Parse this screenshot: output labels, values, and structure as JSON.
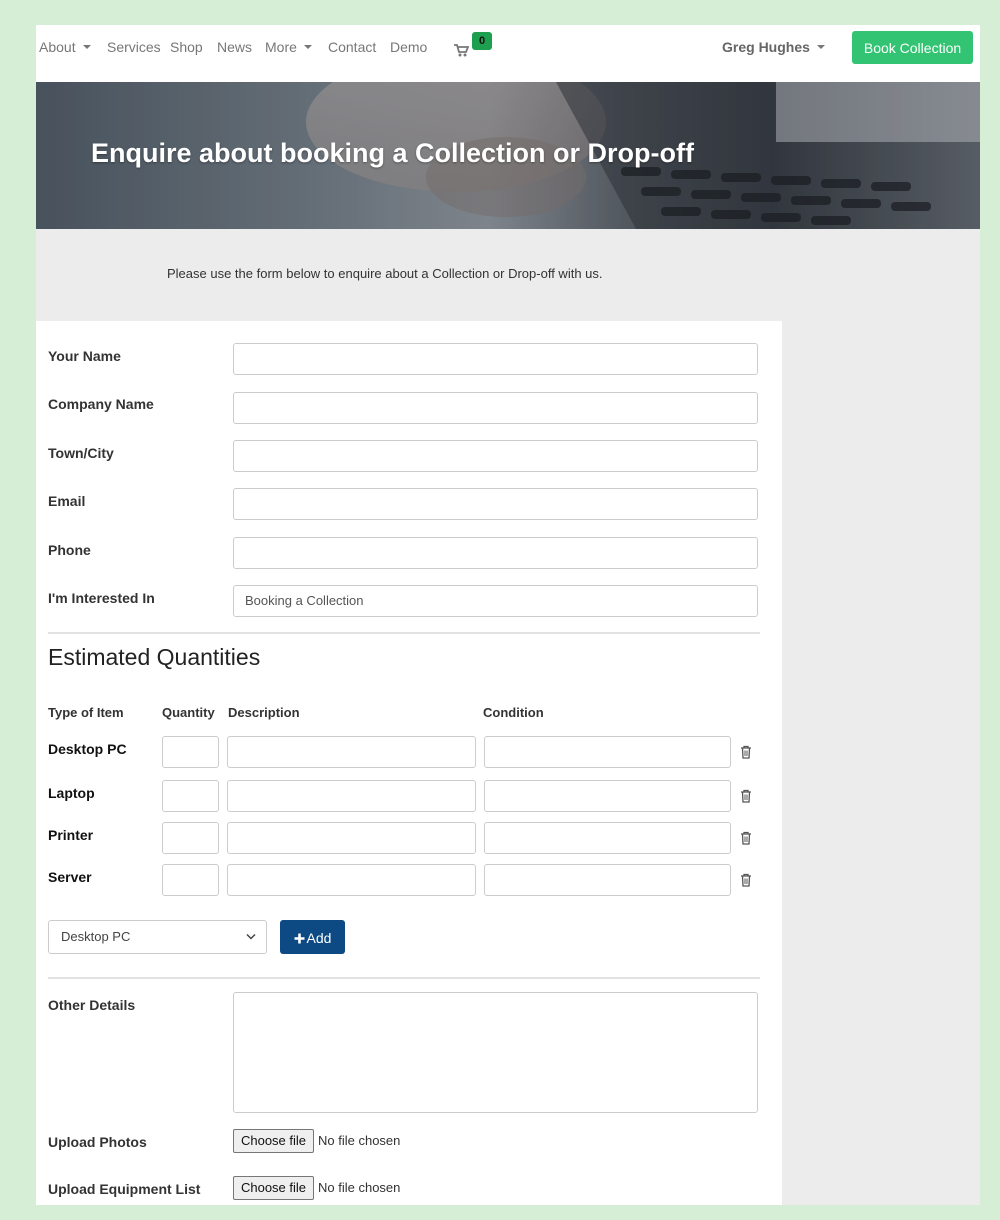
{
  "nav": {
    "items": [
      {
        "label": "About",
        "dropdown": true
      },
      {
        "label": "Services",
        "dropdown": false
      },
      {
        "label": "Shop",
        "dropdown": false
      },
      {
        "label": "News",
        "dropdown": false
      },
      {
        "label": "More",
        "dropdown": true
      },
      {
        "label": "Contact",
        "dropdown": false
      },
      {
        "label": "Demo",
        "dropdown": false
      }
    ],
    "cart_count": "0",
    "cart_icon": "shopping-cart-icon",
    "user_name": "Greg Hughes",
    "cta_label": "Book Collection"
  },
  "hero": {
    "title": "Enquire about booking a Collection or Drop-off"
  },
  "intro": "Please use the form below to enquire about a Collection or Drop-off with us.",
  "form": {
    "fields": [
      {
        "label": "Your Name",
        "value": ""
      },
      {
        "label": "Company Name",
        "value": ""
      },
      {
        "label": "Town/City",
        "value": ""
      },
      {
        "label": "Email",
        "value": ""
      },
      {
        "label": "Phone",
        "value": ""
      },
      {
        "label": "I'm Interested In",
        "value": "Booking a Collection"
      }
    ],
    "quantities": {
      "title": "Estimated Quantities",
      "columns": [
        "Type of Item",
        "Quantity",
        "Description",
        "Condition"
      ],
      "rows": [
        {
          "type": "Desktop PC",
          "quantity": "",
          "description": "",
          "condition": ""
        },
        {
          "type": "Laptop",
          "quantity": "",
          "description": "",
          "condition": ""
        },
        {
          "type": "Printer",
          "quantity": "",
          "description": "",
          "condition": ""
        },
        {
          "type": "Server",
          "quantity": "",
          "description": "",
          "condition": ""
        }
      ],
      "delete_icon": "trash-icon",
      "select_value": "Desktop PC",
      "add_label": "Add"
    },
    "other_details_label": "Other Details",
    "uploads": [
      {
        "label": "Upload Photos",
        "button": "Choose file",
        "status": "No file chosen"
      },
      {
        "label": "Upload Equipment List",
        "button": "Choose file",
        "status": "No file chosen"
      }
    ]
  },
  "colors": {
    "page_bg": "#d6eed6",
    "cta_green": "#33c473",
    "badge_green": "#1e9f50",
    "add_button_blue": "#0d4a83"
  }
}
